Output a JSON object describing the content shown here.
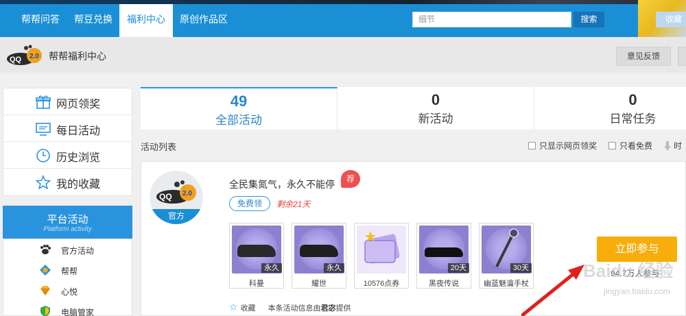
{
  "topnav": {
    "items": [
      "帮帮问答",
      "帮豆兑换",
      "福利中心",
      "原创作品区"
    ],
    "active_index": 2,
    "search_placeholder": "细节",
    "search_button": "搜索",
    "favorite_label": "收藏"
  },
  "subheader": {
    "title": "帮帮福利中心",
    "feedback_label": "意见反馈"
  },
  "sidebar": {
    "items": [
      {
        "label": "网页领奖",
        "icon": "gift-icon"
      },
      {
        "label": "每日活动",
        "icon": "monitor-icon"
      },
      {
        "label": "历史浏览",
        "icon": "clock-icon"
      },
      {
        "label": "我的收藏",
        "icon": "star-icon"
      }
    ],
    "platform": {
      "title": "平台活动",
      "subtitle": "Platform activity",
      "items": [
        {
          "label": "官方活动",
          "icon": "paw-icon"
        },
        {
          "label": "帮帮",
          "icon": "helper-icon"
        },
        {
          "label": "心悦",
          "icon": "diamond-icon"
        },
        {
          "label": "电脑管家",
          "icon": "shield-icon"
        }
      ]
    }
  },
  "tabs": [
    {
      "count": "49",
      "label": "全部活动"
    },
    {
      "count": "0",
      "label": "新活动"
    },
    {
      "count": "0",
      "label": "日常任务"
    }
  ],
  "list": {
    "title": "活动列表",
    "filters": [
      "只显示网页领奖",
      "只看免费",
      "时"
    ]
  },
  "activity": {
    "avatar_band": "官方",
    "title": "全民集氮气，永久不能停",
    "recommend_badge": "荐",
    "free_tag": "免费领",
    "remaining": "剩余21天",
    "rewards": [
      {
        "name": "科曼",
        "duration": "永久"
      },
      {
        "name": "耀世",
        "duration": "永久"
      },
      {
        "name": "10576点券",
        "duration": ""
      },
      {
        "name": "黑夜传说",
        "duration": "20天"
      },
      {
        "name": "幽蓝魅瀹手杖",
        "duration": "30天"
      }
    ],
    "join_button": "立即参与",
    "participants": "94.7万人参与",
    "favorite_label": "收藏",
    "provider_prefix": "本条活动信息由",
    "provider_name": "君宓",
    "provider_suffix": "提供"
  },
  "watermark": {
    "main": "Baidu 经验",
    "sub": "jingyan.baidu.com"
  },
  "colors": {
    "brand_blue": "#1a8fd6",
    "join_orange": "#f7ad0a",
    "remaining_red": "#e5403d",
    "reward_purple": "#8f7fd0"
  }
}
